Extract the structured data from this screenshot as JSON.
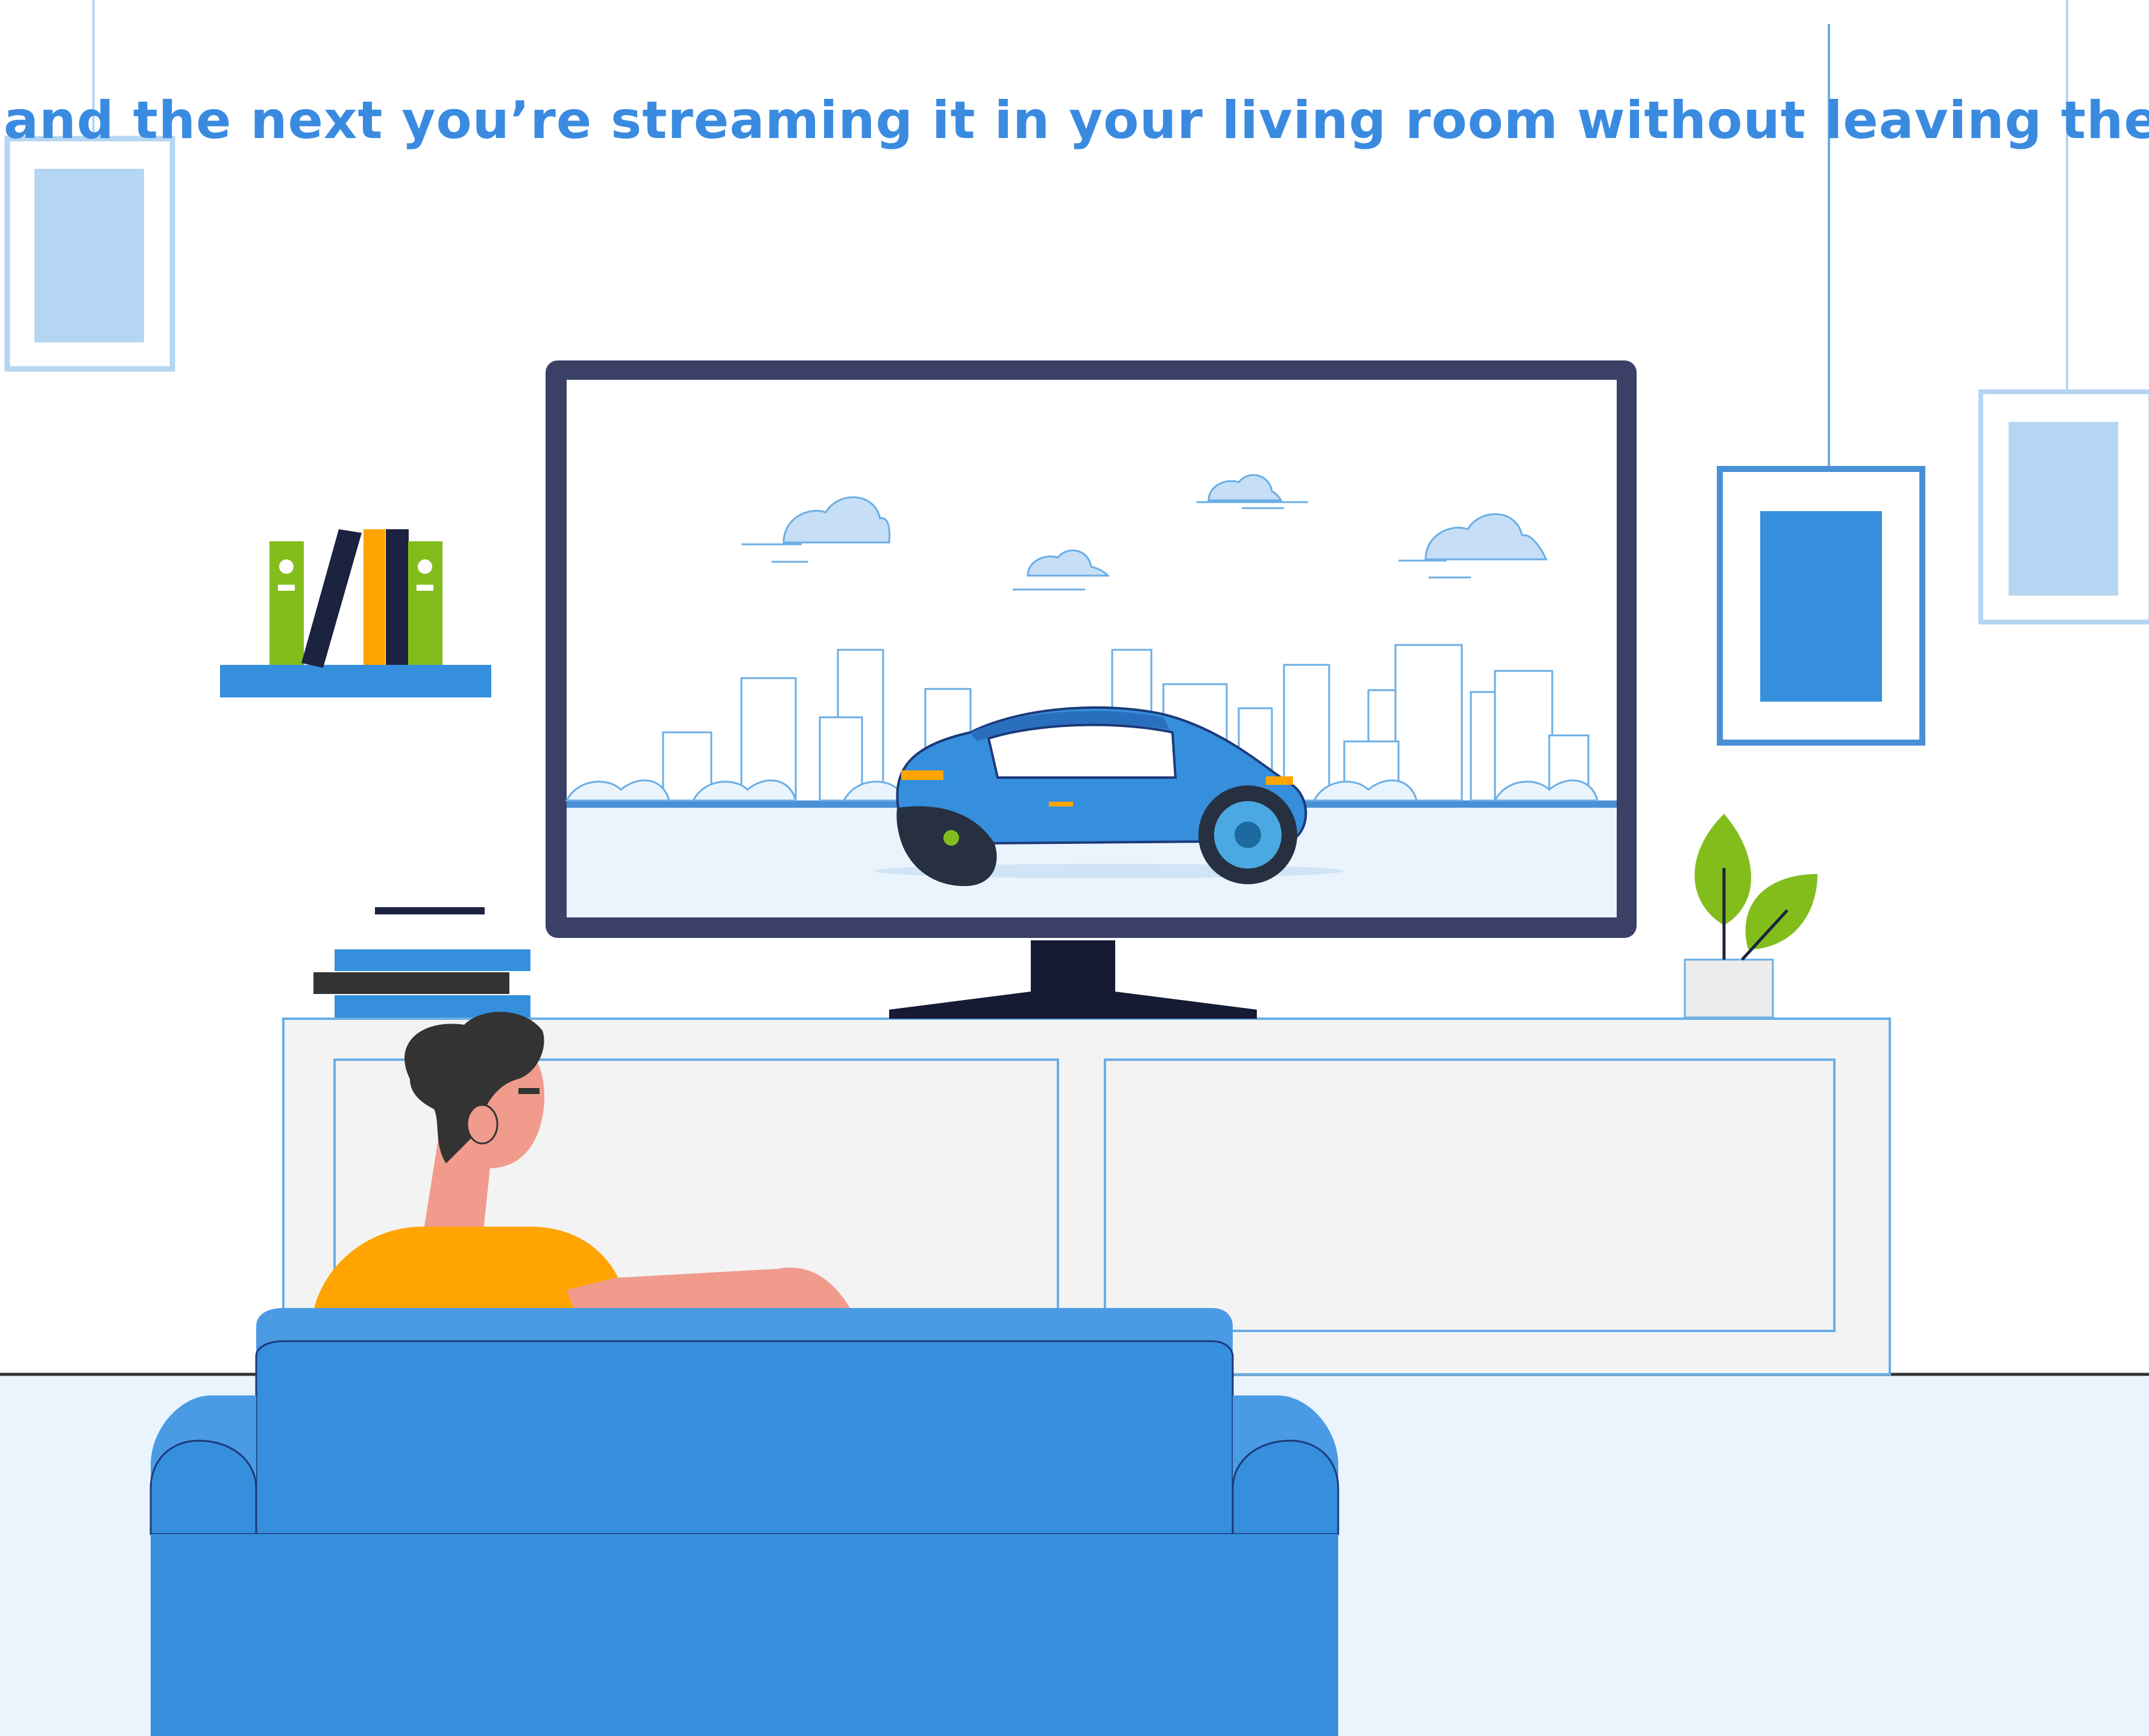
{
  "caption": {
    "text": "and the next you’re streaming it in your living room without leaving the couch"
  },
  "palette": {
    "wall": "#ffffff",
    "floor": "#eaf4fd",
    "accent_blue": "#3a8be0",
    "couch_blue": "#358fdd",
    "couch_top": "#4a9be4",
    "tv_frame": "#3a4066",
    "tv_stand": "#161a33",
    "frame_light": "#b5d6f3",
    "shirt": "#ffa400",
    "skin": "#f09b8c",
    "hair": "#333333",
    "plant_green": "#82bd1c",
    "cabinet": "#f3f3f3"
  },
  "icons": [
    "picture-frame-icon",
    "book-icon",
    "television-icon",
    "car-icon",
    "cloud-icon",
    "plant-icon",
    "couch-icon",
    "person-icon"
  ]
}
